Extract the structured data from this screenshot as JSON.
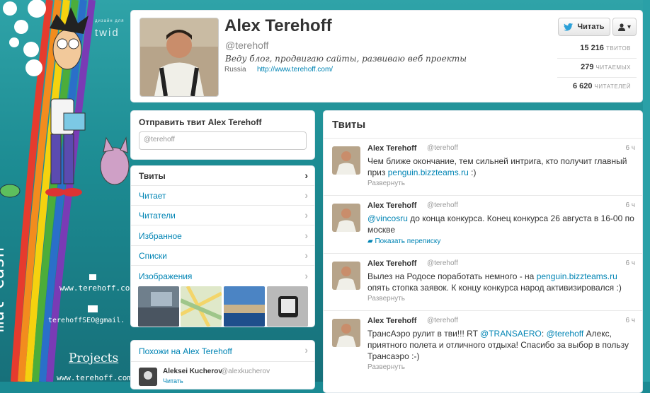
{
  "background": {
    "brand_small": "дизайн для",
    "brand_text": "twid",
    "site_text": "www.terehoff.com",
    "email_text": "terehoffSEO@gmail.",
    "projects_text": "Projects",
    "site_text_2": "www.terehoff.com",
    "side_text": "mul-Cash",
    "colors": {
      "teal": "#1b8a93"
    }
  },
  "profile": {
    "name": "Alex Terehoff",
    "handle": "@terehoff",
    "bio": "Веду блог, продвигаю сайты, развиваю веб проекты",
    "location": "Russia",
    "url": "http://www.terehoff.com/",
    "follow_label": "Читать",
    "stats": [
      {
        "value": "15 216",
        "label": "ТВИТОВ"
      },
      {
        "value": "279",
        "label": "ЧИТАЕМЫХ"
      },
      {
        "value": "6 620",
        "label": "ЧИТАТЕЛЕЙ"
      }
    ]
  },
  "compose": {
    "title": "Отправить твит Alex Terehoff",
    "value": "@terehoff"
  },
  "nav": {
    "items": [
      {
        "label": "Твиты"
      },
      {
        "label": "Читает"
      },
      {
        "label": "Читатели"
      },
      {
        "label": "Избранное"
      },
      {
        "label": "Списки"
      },
      {
        "label": "Изображения"
      }
    ]
  },
  "similar": {
    "title": "Похожи на Alex Terehoff",
    "user_name": "Aleksei Kucherov",
    "user_handle": "@alexkucherov",
    "follow_label": "Читать"
  },
  "timeline": {
    "title": "Твиты",
    "tweets": [
      {
        "name": "Alex Terehoff",
        "handle": "@terehoff",
        "time": "6 ч",
        "text_a": "Чем ближе окончание, тем сильней интрига, кто получит главный приз ",
        "link_a": "penguin.bizzteams.ru",
        "text_b": " :)",
        "expand": "Развернуть"
      },
      {
        "name": "Alex Terehoff",
        "handle": "@terehoff",
        "time": "6 ч",
        "link_a": "@vincosru",
        "text_a": " до конца конкурса. Конец конкурса 26 августа в 16-00 по москве",
        "expand": "Показать переписку"
      },
      {
        "name": "Alex Terehoff",
        "handle": "@terehoff",
        "time": "6 ч",
        "text_a": "Вылез на Родосе поработать немного - на ",
        "link_a": "penguin.bizzteams.ru",
        "text_b": " опять стопка заявок. К концу конкурса народ активизировался :)",
        "expand": "Развернуть"
      },
      {
        "name": "Alex Terehoff",
        "handle": "@terehoff",
        "time": "6 ч",
        "text_a": "ТрансАэро рулит в тви!!! RT ",
        "link_a": "@TRANSAERO",
        "text_b": ": ",
        "link_b": "@terehoff",
        "text_c": " Алекс, приятного полета и отличного отдыха! Спасибо за выбор в пользу Трансаэро :-)",
        "expand": "Развернуть"
      }
    ]
  }
}
